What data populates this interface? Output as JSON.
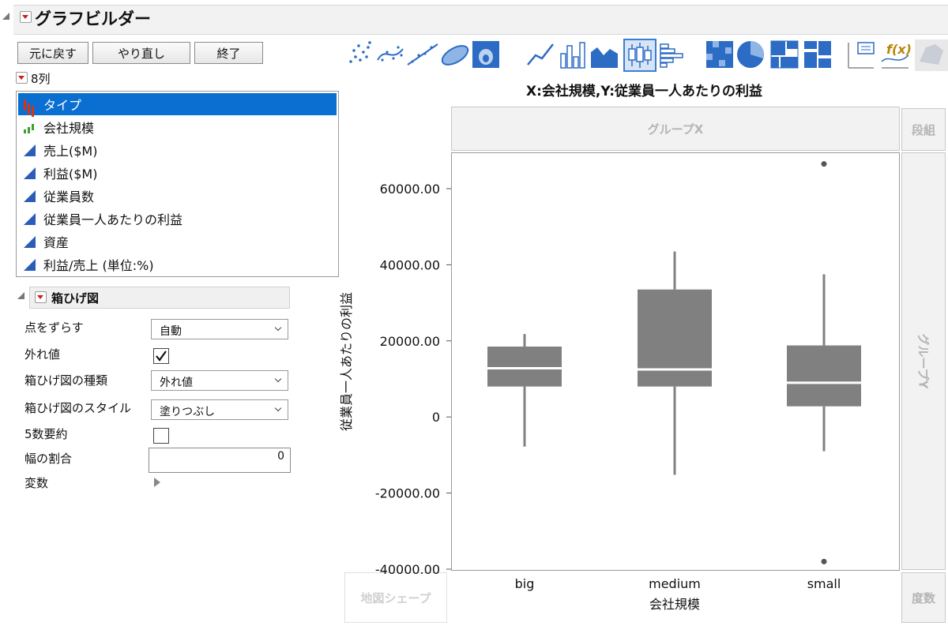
{
  "app": {
    "title": "グラフビルダー"
  },
  "actions": {
    "undo": "元に戻す",
    "redo": "やり直し",
    "done": "終了"
  },
  "columns": {
    "header": "8列",
    "items": [
      {
        "label": "タイプ",
        "type": "nominal",
        "selected": true
      },
      {
        "label": "会社規模",
        "type": "ordinal",
        "selected": false
      },
      {
        "label": "売上($M)",
        "type": "continuous",
        "selected": false
      },
      {
        "label": "利益($M)",
        "type": "continuous",
        "selected": false
      },
      {
        "label": "従業員数",
        "type": "continuous",
        "selected": false
      },
      {
        "label": "従業員一人あたりの利益",
        "type": "continuous",
        "selected": false
      },
      {
        "label": "資産",
        "type": "continuous",
        "selected": false
      },
      {
        "label": "利益/売上 (単位:%)",
        "type": "continuous",
        "selected": false
      }
    ]
  },
  "boxplot_panel": {
    "title": "箱ひげ図",
    "jitter_label": "点をずらす",
    "jitter_value": "自動",
    "outliers_label": "外れ値",
    "outliers_checked": true,
    "box_type_label": "箱ひげ図の種類",
    "box_type_value": "外れ値",
    "box_style_label": "箱ひげ図のスタイル",
    "box_style_value": "塗りつぶし",
    "five_number_label": "5数要約",
    "five_number_checked": false,
    "width_ratio_label": "幅の割合",
    "width_ratio_value": "0",
    "variables_label": "変数"
  },
  "toolbar": {
    "icons": [
      "points-icon",
      "smoother-icon",
      "line-of-fit-icon",
      "ellipse-icon",
      "contour-icon",
      "line-icon",
      "bar-icon",
      "area-icon",
      "box-plot-icon",
      "histogram-icon",
      "heatmap-icon",
      "pie-icon",
      "treemap-icon",
      "mosaic-icon",
      "caption-box-icon",
      "formula-icon",
      "map-shapes-icon"
    ],
    "active": "box-plot-icon"
  },
  "zones": {
    "group_x": "グループX",
    "group_y": "グループY",
    "wrap": "段組",
    "map_shape": "地図シェープ",
    "freq": "度数"
  },
  "chart_data": {
    "type": "box",
    "title": "X:会社規模,Y:従業員一人あたりの利益",
    "xlabel": "会社規模",
    "ylabel": "従業員一人あたりの利益",
    "ylim": [
      -40000,
      70000
    ],
    "yticks": [
      "60000.00",
      "40000.00",
      "20000.00",
      "0",
      "-20000.00",
      "-40000.00"
    ],
    "ytick_values": [
      60000,
      40000,
      20000,
      0,
      -20000,
      -40000
    ],
    "categories": [
      "big",
      "medium",
      "small"
    ],
    "boxes": [
      {
        "category": "big",
        "whisker_low": -7800,
        "q1": 8000,
        "median": 12800,
        "q3": 18500,
        "whisker_high": 21800,
        "outliers": []
      },
      {
        "category": "medium",
        "whisker_low": -15200,
        "q1": 8000,
        "median": 12500,
        "q3": 33500,
        "whisker_high": 43500,
        "outliers": []
      },
      {
        "category": "small",
        "whisker_low": -9000,
        "q1": 2800,
        "median": 9000,
        "q3": 18800,
        "whisker_high": 37500,
        "outliers": [
          66500,
          -38000
        ]
      }
    ],
    "box_color": "#808080",
    "median_color": "#ffffff"
  }
}
